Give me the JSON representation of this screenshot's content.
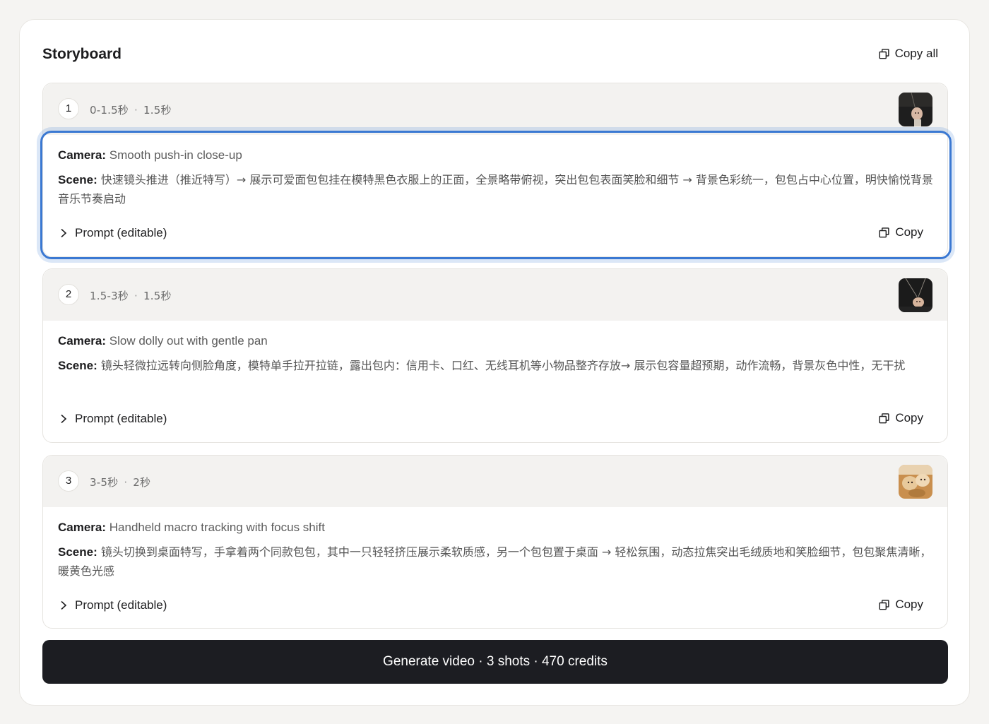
{
  "panel": {
    "title": "Storyboard",
    "copy_all_label": "Copy all"
  },
  "shots": [
    {
      "number": "1",
      "range": "0-1.5秒",
      "duration": "1.5秒",
      "camera_label": "Camera:",
      "camera_value": "Smooth push-in close-up",
      "scene_label": "Scene:",
      "scene_value": "快速镜头推进（推近特写）→ 展示可爱面包包挂在模特黑色衣服上的正面，全景略带俯视，突出包包表面笑脸和细节 → 背景色彩统一，包包占中心位置，明快愉悦背景音乐节奏启动",
      "prompt_label": "Prompt (editable)",
      "copy_label": "Copy",
      "thumb": "thumbnail-dark-bag"
    },
    {
      "number": "2",
      "range": "1.5-3秒",
      "duration": "1.5秒",
      "camera_label": "Camera:",
      "camera_value": "Slow dolly out with gentle pan",
      "scene_label": "Scene:",
      "scene_value": "镜头轻微拉远转向侧脸角度，模特单手拉开拉链，露出包内：信用卡、口红、无线耳机等小物品整齐存放→ 展示包容量超预期，动作流畅，背景灰色中性，无干扰",
      "prompt_label": "Prompt (editable)",
      "copy_label": "Copy",
      "thumb": "thumbnail-dark-bag-side"
    },
    {
      "number": "3",
      "range": "3-5秒",
      "duration": "2秒",
      "camera_label": "Camera:",
      "camera_value": "Handheld macro tracking with focus shift",
      "scene_label": "Scene:",
      "scene_value": "镜头切换到桌面特写，手拿着两个同款包包，其中一只轻轻挤压展示柔软质感，另一个包包置于桌面 → 轻松氛围，动态拉焦突出毛绒质地和笑脸细节，包包聚焦清晰，暖黄色光感",
      "prompt_label": "Prompt (editable)",
      "copy_label": "Copy",
      "thumb": "thumbnail-bread-bags"
    }
  ],
  "generate": {
    "label": "Generate video · 3 shots · 470 credits"
  },
  "colors": {
    "focus": "#3a78d2",
    "button_bg": "#1c1d22",
    "header_bg": "#f3f2f0"
  }
}
